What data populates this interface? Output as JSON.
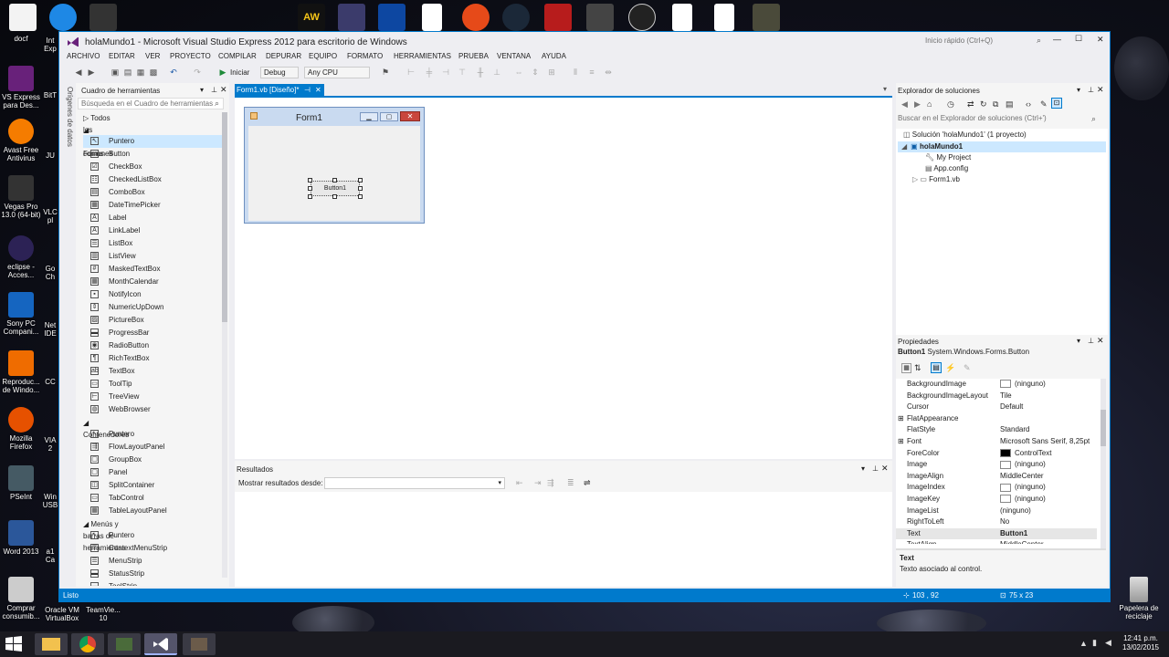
{
  "window": {
    "title": "holaMundo1 - Microsoft Visual Studio Express 2012 para escritorio de Windows",
    "quick_launch": "Inicio rápido (Ctrl+Q)",
    "minimize": "—",
    "maximize": "☐",
    "close": "✕"
  },
  "menu": [
    "ARCHIVO",
    "EDITAR",
    "VER",
    "PROYECTO",
    "COMPILAR",
    "DEPURAR",
    "EQUIPO",
    "FORMATO",
    "HERRAMIENTAS",
    "PRUEBA",
    "VENTANA",
    "AYUDA"
  ],
  "toolbar": {
    "start_label": "Iniciar",
    "config": "Debug",
    "platform": "Any CPU"
  },
  "side_tab": "Orígenes de datos",
  "toolbox": {
    "title": "Cuadro de herramientas",
    "search_placeholder": "Búsqueda en el Cuadro de herramientas",
    "all_forms": "Todos los Windows Forms",
    "cat_common": "Controles comunes",
    "common": [
      "Puntero",
      "Button",
      "CheckBox",
      "CheckedListBox",
      "ComboBox",
      "DateTimePicker",
      "Label",
      "LinkLabel",
      "ListBox",
      "ListView",
      "MaskedTextBox",
      "MonthCalendar",
      "NotifyIcon",
      "NumericUpDown",
      "PictureBox",
      "ProgressBar",
      "RadioButton",
      "RichTextBox",
      "TextBox",
      "ToolTip",
      "TreeView",
      "WebBrowser"
    ],
    "cat_containers": "Contenedores",
    "containers": [
      "Puntero",
      "FlowLayoutPanel",
      "GroupBox",
      "Panel",
      "SplitContainer",
      "TabControl",
      "TableLayoutPanel"
    ],
    "cat_menus": "Menús y barras de herramientas",
    "menus": [
      "Puntero",
      "ContextMenuStrip",
      "MenuStrip",
      "StatusStrip",
      "ToolStrip"
    ]
  },
  "document_tab": "Form1.vb [Diseño]*",
  "designer": {
    "form_title": "Form1",
    "button_text": "Button1"
  },
  "output": {
    "title": "Resultados",
    "show_from": "Mostrar resultados desde:"
  },
  "solution_explorer": {
    "title": "Explorador de soluciones",
    "search_placeholder": "Buscar en el Explorador de soluciones (Ctrl+')",
    "solution": "Solución 'holaMundo1' (1 proyecto)",
    "project": "holaMundo1",
    "items": [
      "My Project",
      "App.config",
      "Form1.vb"
    ]
  },
  "properties": {
    "title": "Propiedades",
    "object": "Button1",
    "object_type": "System.Windows.Forms.Button",
    "rows": [
      {
        "name": "BackgroundImage",
        "value": "(ninguno)",
        "swatch": "#ffffff"
      },
      {
        "name": "BackgroundImageLayout",
        "value": "Tile"
      },
      {
        "name": "Cursor",
        "value": "Default"
      },
      {
        "name": "FlatAppearance",
        "value": "",
        "expander": "⊞"
      },
      {
        "name": "FlatStyle",
        "value": "Standard"
      },
      {
        "name": "Font",
        "value": "Microsoft Sans Serif, 8,25pt",
        "expander": "⊞"
      },
      {
        "name": "ForeColor",
        "value": "ControlText",
        "swatch": "#000000"
      },
      {
        "name": "Image",
        "value": "(ninguno)",
        "swatch": "#ffffff"
      },
      {
        "name": "ImageAlign",
        "value": "MiddleCenter"
      },
      {
        "name": "ImageIndex",
        "value": "(ninguno)",
        "swatch": "#ffffff"
      },
      {
        "name": "ImageKey",
        "value": "(ninguno)",
        "swatch": "#ffffff"
      },
      {
        "name": "ImageList",
        "value": "(ninguno)"
      },
      {
        "name": "RightToLeft",
        "value": "No"
      },
      {
        "name": "Text",
        "value": "Button1",
        "bold": true
      },
      {
        "name": "TextAlign",
        "value": "MiddleCenter"
      }
    ],
    "desc_title": "Text",
    "desc_text": "Texto asociado al control."
  },
  "status": {
    "ready": "Listo",
    "position": "103 , 92",
    "size": "75 x 23"
  },
  "desktop_icons": [
    {
      "label": "docf"
    },
    {
      "label": "VS Express para Des..."
    },
    {
      "label": "Avast Free Antivirus"
    },
    {
      "label": "Vegas Pro 13.0 (64-bit)"
    },
    {
      "label": "eclipse - Acces..."
    },
    {
      "label": "Sony PC Compani..."
    },
    {
      "label": "Reproduc... de Windo..."
    },
    {
      "label": "Mozilla Firefox"
    },
    {
      "label": "PSeInt"
    },
    {
      "label": "Word 2013"
    },
    {
      "label": "Comprar consumib..."
    }
  ],
  "desktop_icons_col2": [
    "Int Exp",
    "BitT",
    "JU",
    "VLC pl",
    "Go Ch",
    "Net IDE",
    "CC",
    "VIA 2",
    "Win USB",
    "a1 Ca",
    "Oracle VM VirtualBox"
  ],
  "teamviewer_label": "TeamVie... 10",
  "recycle_label": "Papelera de reciclaje",
  "clock": {
    "time": "12:41 p.m.",
    "date": "13/02/2015"
  },
  "colors": {
    "accent": "#007acc",
    "selection": "#cce8ff"
  }
}
